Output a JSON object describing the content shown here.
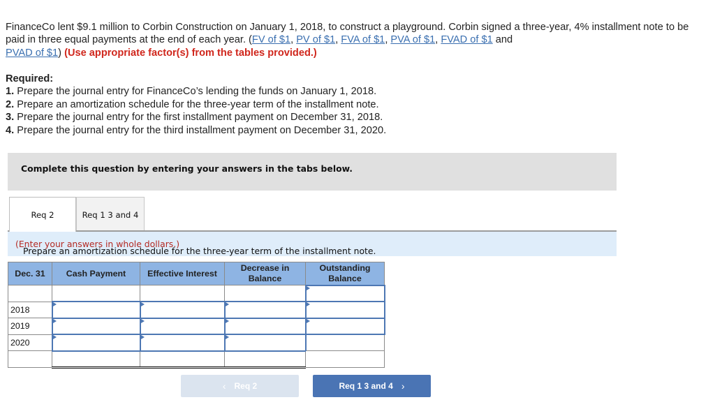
{
  "intro": {
    "text_before_links": "FinanceCo lent $9.1 million to Corbin Construction on January 1, 2018, to construct a playground. Corbin signed a three-year, 4% installment note to be paid in three equal payments at the end of each year. (",
    "links": [
      "FV of $1",
      "PV of $1",
      "FVA of $1",
      "PVA of $1",
      "FVAD of $1",
      "PVAD of $1"
    ],
    "and_word": "and",
    "close_paren": ")",
    "instruction": "(Use appropriate factor(s) from the tables provided.)"
  },
  "required": {
    "heading": "Required:",
    "items": [
      {
        "num": "1.",
        "text": "Prepare the journal entry for FinanceCo’s lending the funds on January 1, 2018."
      },
      {
        "num": "2.",
        "text": "Prepare an amortization schedule for the three-year term of the installment note."
      },
      {
        "num": "3.",
        "text": "Prepare the journal entry for the first installment payment on December 31, 2018."
      },
      {
        "num": "4.",
        "text": "Prepare the journal entry for the third installment payment on December 31, 2020."
      }
    ]
  },
  "banner": "Complete this question by entering your answers in the tabs below.",
  "tabs": [
    {
      "label": "Req 2",
      "active": true
    },
    {
      "label": "Req 1 3 and 4",
      "active": false
    }
  ],
  "prompt": {
    "text": "Prepare an amortization schedule for the three-year term of the installment note.",
    "note": "(Enter your answers in whole dollars.)"
  },
  "schedule": {
    "headers": [
      "Dec. 31",
      "Cash Payment",
      "Effective Interest",
      "Decrease in Balance",
      "Outstanding Balance"
    ],
    "header_lines": [
      [
        "Dec. 31"
      ],
      [
        "Cash Payment"
      ],
      [
        "Effective Interest"
      ],
      [
        "Decrease in",
        "Balance"
      ],
      [
        "Outstanding",
        "Balance"
      ]
    ],
    "rows": [
      {
        "year": "",
        "cash_payment": "",
        "effective_interest": "",
        "decrease_in_balance": "",
        "outstanding_balance": ""
      },
      {
        "year": "2018",
        "cash_payment": "",
        "effective_interest": "",
        "decrease_in_balance": "",
        "outstanding_balance": ""
      },
      {
        "year": "2019",
        "cash_payment": "",
        "effective_interest": "",
        "decrease_in_balance": "",
        "outstanding_balance": ""
      },
      {
        "year": "2020",
        "cash_payment": "",
        "effective_interest": "",
        "decrease_in_balance": "",
        "outstanding_balance": ""
      },
      {
        "year": "",
        "cash_payment": "",
        "effective_interest": "",
        "decrease_in_balance": "",
        "outstanding_balance": ""
      }
    ]
  },
  "nav": {
    "prev_label": "Req 2",
    "next_label": "Req 1 3 and 4",
    "prev_icon": "‹",
    "next_icon": "›"
  },
  "colors": {
    "link": "#3a6fb0",
    "instruction_red": "#d0271d",
    "header_blue": "#8eb4e3",
    "input_border": "#4d77b3",
    "next_button": "#4a74b4",
    "prev_button_disabled": "#dbe4ef"
  }
}
